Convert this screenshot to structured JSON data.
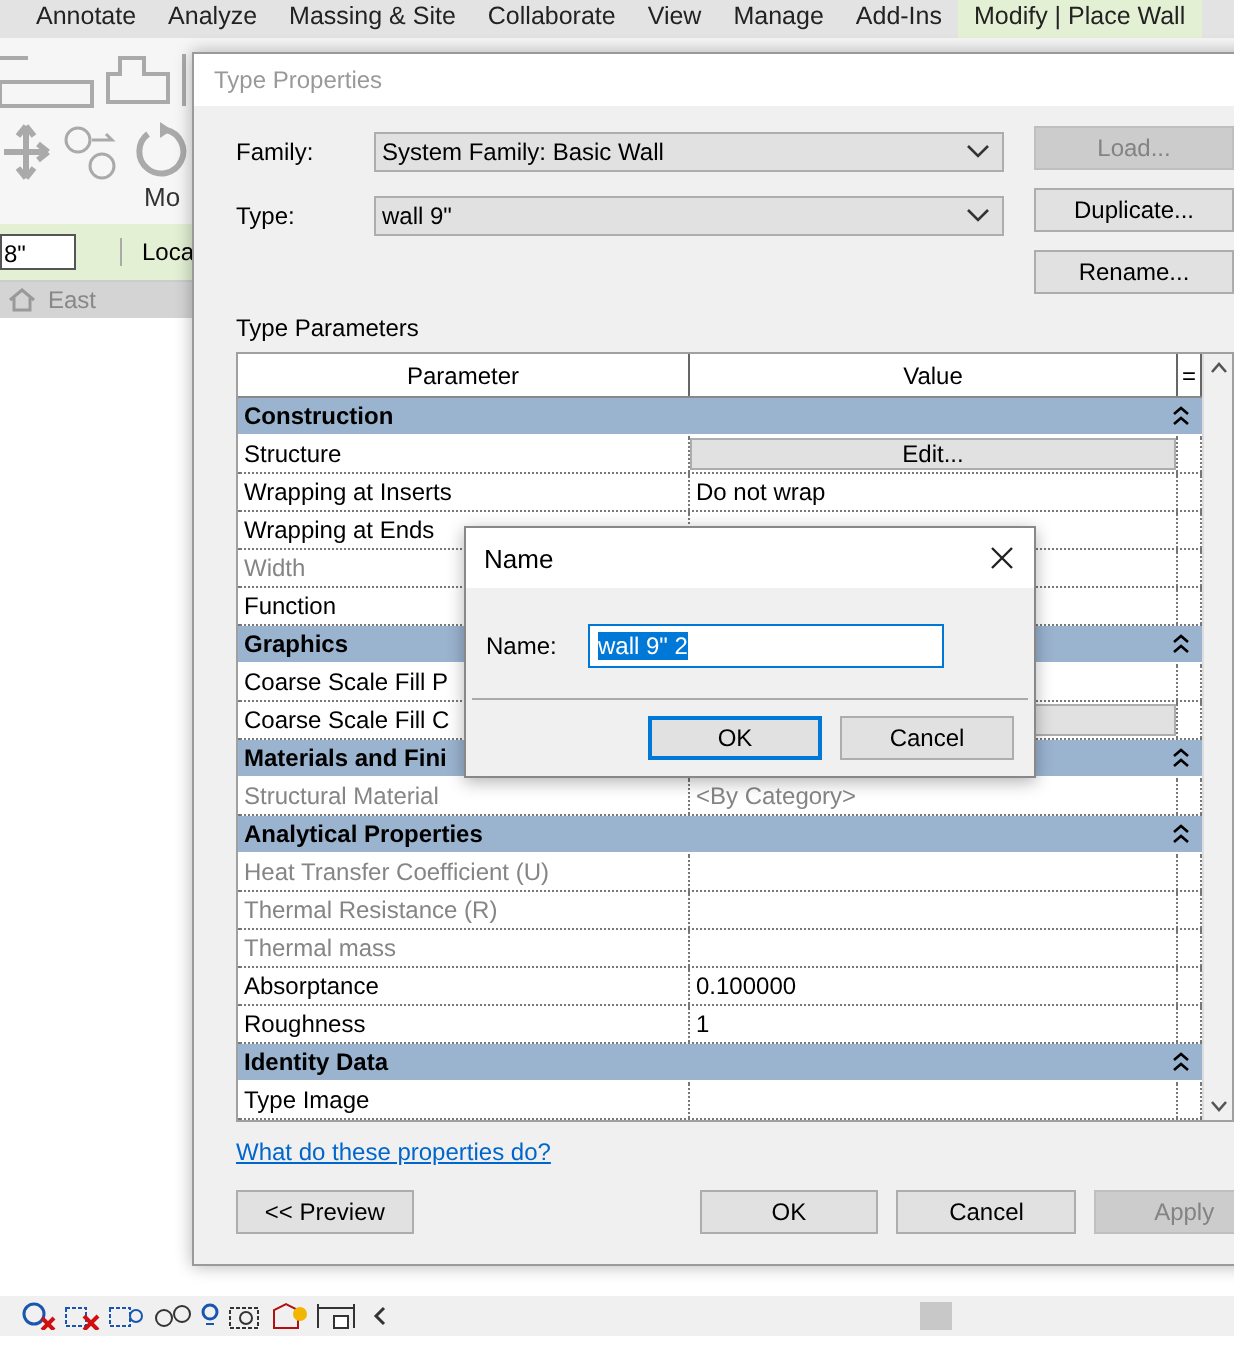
{
  "ribbon_tabs": [
    {
      "label": "Annotate",
      "selected": false
    },
    {
      "label": "Analyze",
      "selected": false
    },
    {
      "label": "Massing & Site",
      "selected": false
    },
    {
      "label": "Collaborate",
      "selected": false
    },
    {
      "label": "View",
      "selected": false
    },
    {
      "label": "Manage",
      "selected": false
    },
    {
      "label": "Add-Ins",
      "selected": false
    },
    {
      "label": "Modify | Place Wall",
      "selected": true
    }
  ],
  "ribbon_panel": {
    "label": "Mo"
  },
  "options_bar": {
    "field_value": "8\"",
    "label": "Loca"
  },
  "view_tab": {
    "label": "East"
  },
  "dialog": {
    "title": "Type Properties",
    "fields": [
      {
        "label": "Family:",
        "value": "System Family: Basic Wall"
      },
      {
        "label": "Type:",
        "value": "wall 9\""
      }
    ],
    "side_buttons": [
      {
        "label": "Load...",
        "disabled": true
      },
      {
        "label": "Duplicate...",
        "disabled": false
      },
      {
        "label": "Rename...",
        "disabled": false
      }
    ],
    "section_label": "Type Parameters",
    "table": {
      "columns": [
        "Parameter",
        "Value",
        "="
      ],
      "groups": [
        {
          "name": "Construction",
          "rows": [
            {
              "name": "Structure",
              "kind": "button",
              "value": "Edit...",
              "disabled": false
            },
            {
              "name": "Wrapping at Inserts",
              "kind": "text",
              "value": "Do not wrap",
              "disabled": false
            },
            {
              "name": "Wrapping at Ends",
              "kind": "text",
              "disabled": false
            },
            {
              "name": "Width",
              "kind": "text",
              "disabled": true
            },
            {
              "name": "Function",
              "kind": "text",
              "disabled": false
            }
          ]
        },
        {
          "name": "Graphics",
          "rows": [
            {
              "name": "Coarse Scale Fill P",
              "kind": "text",
              "disabled": false
            },
            {
              "name": "Coarse Scale Fill C",
              "kind": "button",
              "disabled": false
            }
          ]
        },
        {
          "name": "Materials and Fini",
          "rows": [
            {
              "name": "Structural Material",
              "kind": "text",
              "value": "<By Category>",
              "disabled": true
            }
          ]
        },
        {
          "name": "Analytical Properties",
          "rows": [
            {
              "name": "Heat Transfer Coefficient (U)",
              "kind": "text",
              "disabled": true
            },
            {
              "name": "Thermal Resistance (R)",
              "kind": "text",
              "disabled": true
            },
            {
              "name": "Thermal mass",
              "kind": "text",
              "disabled": true
            },
            {
              "name": "Absorptance",
              "kind": "text",
              "value": "0.100000",
              "disabled": false
            },
            {
              "name": "Roughness",
              "kind": "text",
              "value": "1",
              "disabled": false
            }
          ]
        },
        {
          "name": "Identity Data",
          "rows": [
            {
              "name": "Type Image",
              "kind": "text",
              "disabled": false
            }
          ]
        }
      ]
    },
    "help_link": "What do these properties do?",
    "preview_button": "<< Preview",
    "buttons": [
      {
        "label": "OK",
        "disabled": false
      },
      {
        "label": "Cancel",
        "disabled": false
      },
      {
        "label": "Apply",
        "disabled": true
      }
    ]
  },
  "name_dialog": {
    "title": "Name",
    "label": "Name:",
    "value": "wall 9\" 2",
    "value_selected": true,
    "buttons": [
      {
        "label": "OK",
        "default": true
      },
      {
        "label": "Cancel",
        "default": false
      }
    ]
  }
}
